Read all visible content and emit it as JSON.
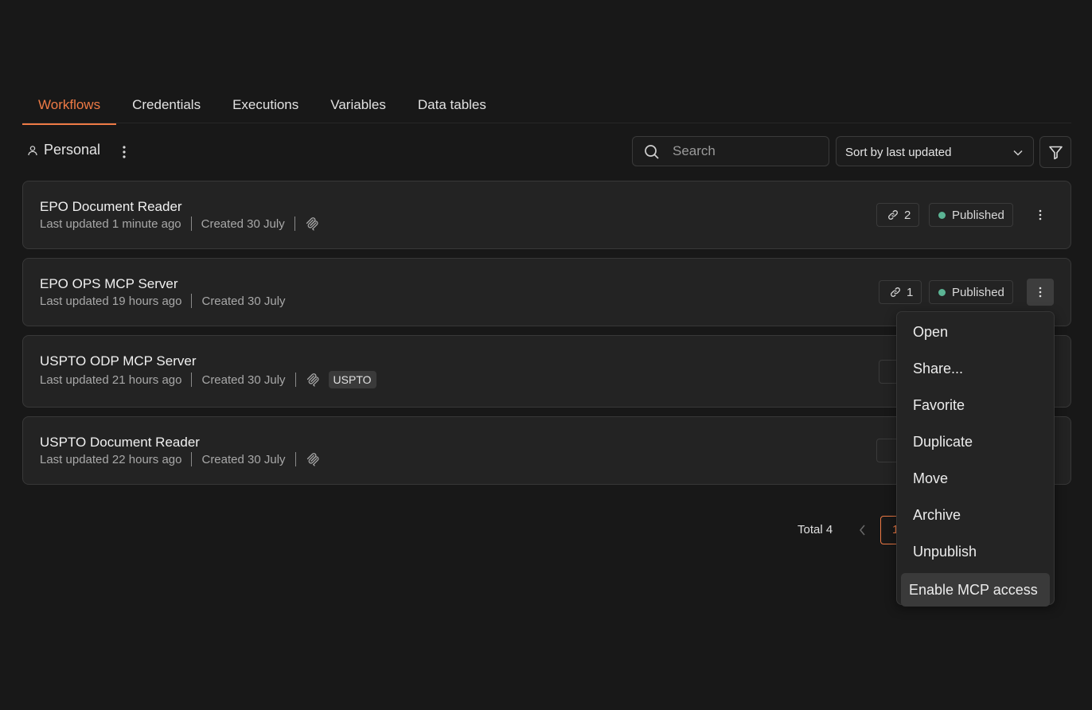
{
  "tabs": [
    {
      "label": "Workflows",
      "active": true
    },
    {
      "label": "Credentials"
    },
    {
      "label": "Executions"
    },
    {
      "label": "Variables"
    },
    {
      "label": "Data tables"
    }
  ],
  "toolbar": {
    "project_label": "Personal",
    "search_placeholder": "Search",
    "sort_label": "Sort by last updated"
  },
  "workflows": [
    {
      "name": "EPO Document Reader",
      "updated": "Last updated 1 minute ago",
      "created": "Created 30 July",
      "links": "2",
      "status": "Published"
    },
    {
      "name": "EPO OPS MCP Server",
      "updated": "Last updated 19 hours ago",
      "created": "Created 30 July",
      "links": "1",
      "status": "Published"
    },
    {
      "name": "USPTO ODP MCP Server",
      "updated": "Last updated 21 hours ago",
      "created": "Created 30 July",
      "tag": "USPTO"
    },
    {
      "name": "USPTO Document Reader",
      "updated": "Last updated 22 hours ago",
      "created": "Created 30 July"
    }
  ],
  "pagination": {
    "total": "Total 4",
    "current": "1"
  },
  "context_menu": {
    "items": [
      "Open",
      "Share...",
      "Favorite",
      "Duplicate",
      "Move",
      "Archive",
      "Unpublish",
      "Enable MCP access"
    ],
    "highlighted": "Enable MCP access"
  },
  "colors": {
    "accent": "#ee7a45",
    "published": "#5bb494",
    "background": "#181818"
  }
}
